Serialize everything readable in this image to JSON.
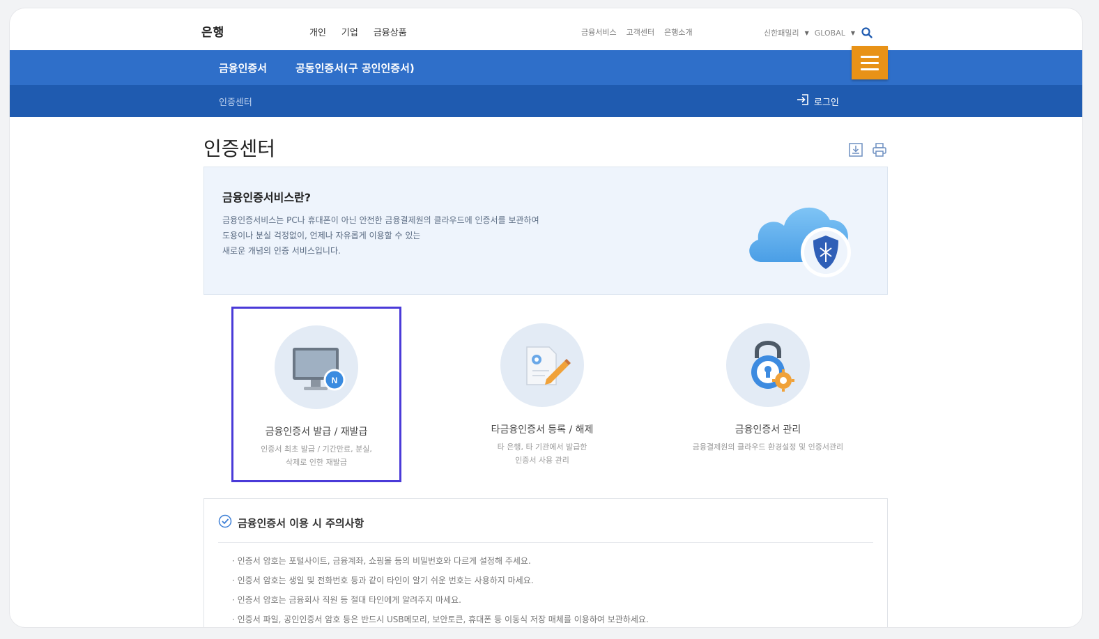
{
  "header": {
    "brand": "은행",
    "main_nav": [
      "개인",
      "기업",
      "금융상품"
    ],
    "util_nav": [
      "금융서비스",
      "고객센터",
      "은행소개"
    ],
    "family_site": "신한패밀리",
    "global": "GLOBAL"
  },
  "menu_bar": {
    "item1": "금융인증서",
    "item2": "공동인증서(구 공인인증서)",
    "sub_item": "인증센터",
    "login": "로그인"
  },
  "page": {
    "title": "인증센터"
  },
  "info_box": {
    "title": "금융인증서비스란?",
    "lines": [
      "금융인증서비스는 PC나 휴대폰이 아닌 안전한 금융결제원의 클라우드에 인증서를 보관하여",
      "도용이나 분실 걱정없이, 언제나 자유롭게 이용할 수 있는",
      "새로운 개념의 인증 서비스입니다."
    ]
  },
  "cards": [
    {
      "title": "금융인증서 발급 / 재발급",
      "desc": [
        "인증서 최초 발급 / 기간만료, 분실,",
        "삭제로 인한 재발급"
      ],
      "icon": "monitor-icon"
    },
    {
      "title": "타금융인증서 등록 / 해제",
      "desc": [
        "타 은행, 타 기관에서 발급한",
        "인증서 사용 관리"
      ],
      "icon": "certificate-pen-icon"
    },
    {
      "title": "금융인증서 관리",
      "desc": [
        "금융결제원의 클라우드 환경설정 및 인증서관리"
      ],
      "icon": "lock-gear-icon"
    }
  ],
  "notice": {
    "title": "금융인증서 이용 시 주의사항",
    "items": [
      "· 인증서 암호는 포털사이트, 금융계좌, 쇼핑몰 등의 비밀번호와 다르게 설정해 주세요.",
      "· 인증서 암호는 생일 및 전화번호 등과 같이 타인이 알기 쉬운 번호는 사용하지 마세요.",
      "· 인증서 암호는 금융회사 직원 등 절대 타인에게 알려주지 마세요.",
      "· 인증서 파일, 공인인증서 암호 등은 반드시 USB메모리, 보안토큰, 휴대폰 등 이동식 저장 매체를 이용하여 보관하세요."
    ]
  },
  "colors": {
    "primary_blue": "#2f6fc9",
    "dark_blue": "#1f5bb0",
    "menu_orange": "#e89217",
    "selection": "#4a3ad8"
  }
}
